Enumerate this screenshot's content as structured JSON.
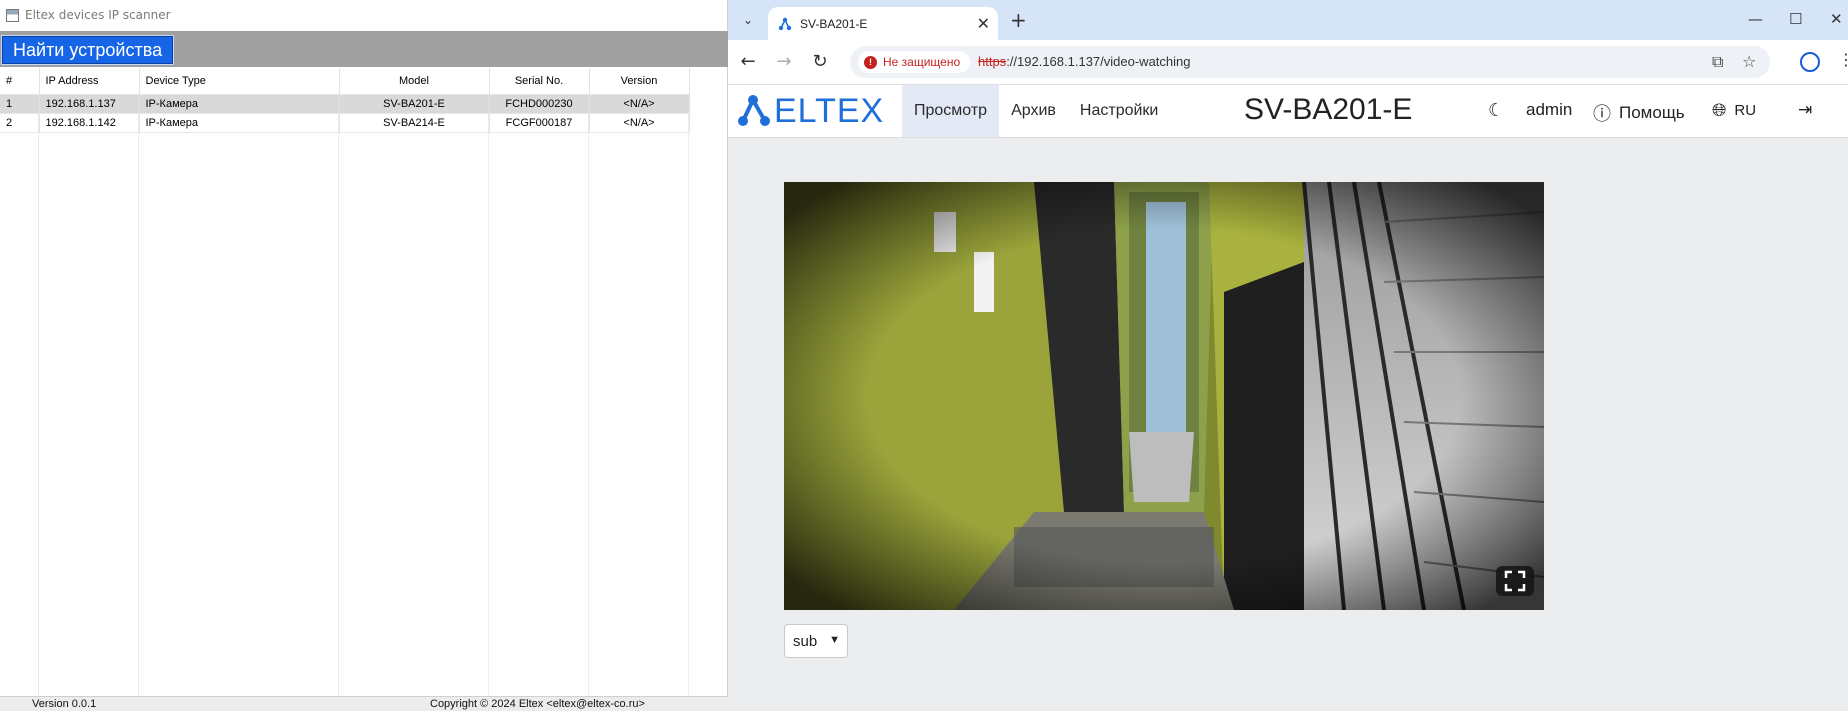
{
  "scanner": {
    "window_title": "Eltex devices IP scanner",
    "find_button": "Найти устройства",
    "columns": [
      "#",
      "IP Address",
      "Device Type",
      "Model",
      "Serial No.",
      "Version"
    ],
    "rows": [
      {
        "num": "1",
        "ip": "192.168.1.137",
        "type": "IP-Камера",
        "model": "SV-BA201-E",
        "serial": "FCHD000230",
        "version": "<N/A>",
        "selected": true
      },
      {
        "num": "2",
        "ip": "192.168.1.142",
        "type": "IP-Камера",
        "model": "SV-BA214-E",
        "serial": "FCGF000187",
        "version": "<N/A>",
        "selected": false
      }
    ],
    "status_version": "Version 0.0.1",
    "status_copyright": "Copyright © 2024 Eltex <eltex@eltex-co.ru>"
  },
  "browser": {
    "tab_title": "SV-BA201-E",
    "security_label": "Не защищено",
    "url_protocol": "https",
    "url_rest": "://192.168.1.137/video-watching"
  },
  "page": {
    "logo_text": "ELTEX",
    "nav": [
      "Просмотр",
      "Архив",
      "Настройки"
    ],
    "device_title": "SV-BA201-E",
    "user": "admin",
    "help": "Помощь",
    "language": "RU",
    "stream_option": "sub"
  },
  "colors": {
    "accent_blue": "#1565e6",
    "eltex_blue": "#1e6fd9",
    "insecure_red": "#c5221f",
    "tabstrip": "#d6e4f7"
  }
}
